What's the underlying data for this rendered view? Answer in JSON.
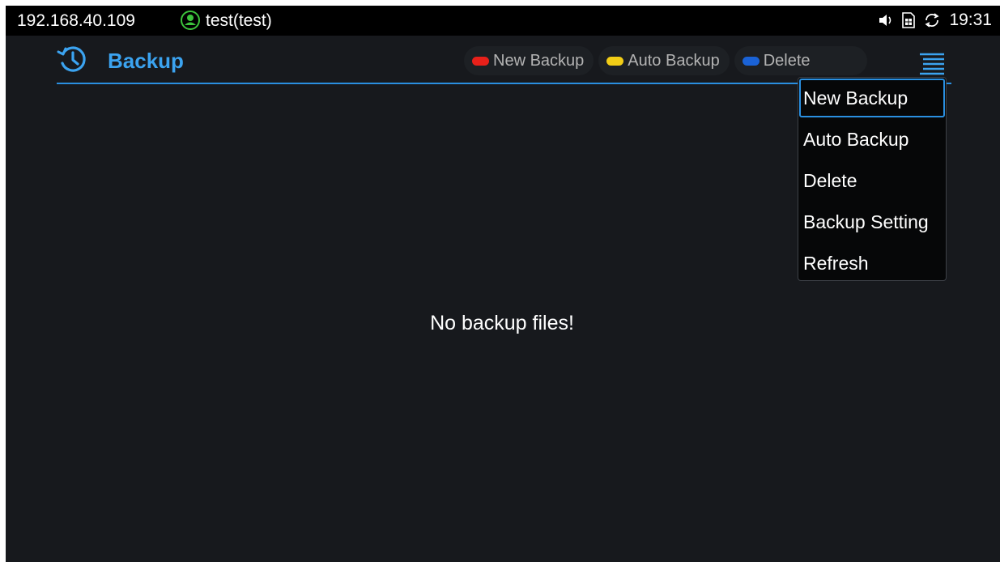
{
  "statusbar": {
    "ip": "192.168.40.109",
    "account": "test(test)",
    "time": "19:31",
    "icons": [
      "account-icon",
      "speaker-icon",
      "sim-icon",
      "sync-icon"
    ]
  },
  "header": {
    "title": "Backup",
    "icon": "backup-history-icon",
    "menu_icon": "menu-icon"
  },
  "hints": [
    {
      "label": "New Backup",
      "color": "#e8201a"
    },
    {
      "label": "Auto Backup",
      "color": "#f2cd16"
    },
    {
      "label": "Delete",
      "color": "#1a62d6"
    }
  ],
  "dropdown": {
    "items": [
      {
        "label": "New Backup",
        "selected": true
      },
      {
        "label": "Auto Backup"
      },
      {
        "label": "Delete"
      },
      {
        "label": "Backup Setting"
      },
      {
        "label": "Refresh"
      }
    ]
  },
  "content": {
    "empty_message": "No backup files!"
  },
  "colors": {
    "accent": "#2a8fe0",
    "title": "#3ba3f0",
    "background": "#17191d",
    "account_green": "#3cc43c"
  }
}
